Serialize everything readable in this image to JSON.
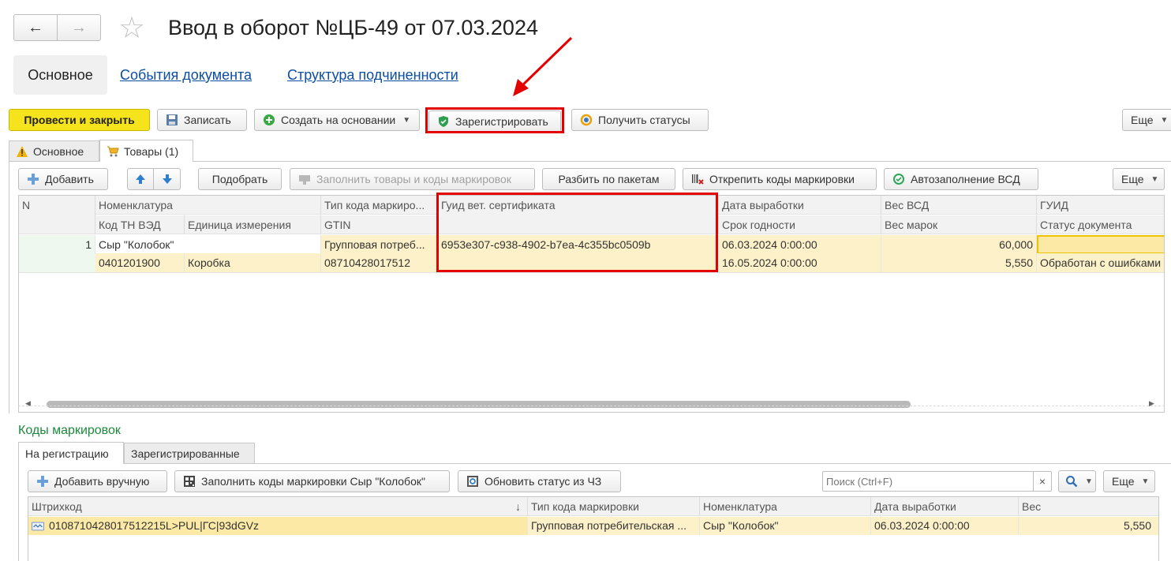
{
  "header": {
    "title": "Ввод в оборот №ЦБ-49 от 07.03.2024",
    "nav_back": "←",
    "nav_forward": "→",
    "star": "☆"
  },
  "sections": {
    "main": "Основное",
    "events": "События документа",
    "structure": "Структура подчиненности"
  },
  "toolbar": {
    "post_close": "Провести и закрыть",
    "save": "Записать",
    "create_based": "Создать на основании",
    "register": "Зарегистрировать",
    "get_statuses": "Получить статусы",
    "more": "Еще"
  },
  "tabs": {
    "main": "Основное",
    "goods": "Товары (1)"
  },
  "goods_toolbar": {
    "add": "Добавить",
    "pick": "Подобрать",
    "fill_goods": "Заполнить товары и коды маркировок",
    "split": "Разбить по пакетам",
    "unpin": "Открепить коды маркировки",
    "autofill": "Автозаполнение ВСД",
    "more": "Еще"
  },
  "goods_table": {
    "headers_row1": {
      "n": "N",
      "nomenclature": "Номенклатура",
      "code_type": "Тип кода маркиро...",
      "guid_cert": "Гуид вет. сертификата",
      "prod_date": "Дата выработки",
      "weight_vsd": "Вес ВСД",
      "guid": "ГУИД"
    },
    "headers_row2": {
      "tnved": "Код ТН ВЭД",
      "unit": "Единица измерения",
      "gtin": "GTIN",
      "expiry": "Срок годности",
      "weight_marks": "Вес марок",
      "doc_status": "Статус документа"
    },
    "row": {
      "n": "1",
      "nomenclature": "Сыр \"Колобок\"",
      "code_type": "Групповая потреб...",
      "guid_cert": "6953e307-c938-4902-b7ea-4c355bc0509b",
      "prod_date": "06.03.2024 0:00:00",
      "weight_vsd": "60,000",
      "guid": "",
      "tnved": "0401201900",
      "unit": "Коробка",
      "gtin": "08710428017512",
      "expiry": "16.05.2024 0:00:00",
      "weight_marks": "5,550",
      "doc_status": "Обработан с ошибками"
    }
  },
  "codes": {
    "title": "Коды маркировок",
    "tab_pending": "На регистрацию",
    "tab_registered": "Зарегистрированные",
    "add_manual": "Добавить вручную",
    "fill_codes": "Заполнить коды маркировки Сыр \"Колобок\"",
    "refresh_status": "Обновить статус из ЧЗ",
    "search_placeholder": "Поиск (Ctrl+F)",
    "clear": "×",
    "more": "Еще",
    "headers": {
      "barcode": "Штрихкод",
      "sort": "↓",
      "code_type": "Тип кода маркировки",
      "nomenclature": "Номенклатура",
      "prod_date": "Дата выработки",
      "weight": "Вес"
    },
    "row": {
      "barcode": "0108710428017512215L>PUL|ГС|93dGVz",
      "code_type": "Групповая потребительская ...",
      "nomenclature": "Сыр \"Колобок\"",
      "prod_date": "06.03.2024 0:00:00",
      "weight": "5,550"
    }
  },
  "colors": {
    "accent_yellow": "#f5e31b",
    "highlight_red": "#e50000",
    "section_green": "#1c8a3a",
    "link_blue": "#0b4ea2"
  }
}
